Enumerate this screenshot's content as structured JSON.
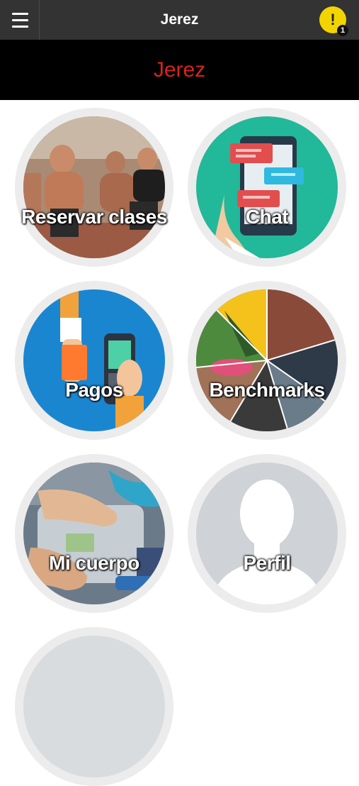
{
  "header": {
    "title": "Jerez",
    "notification_count": "1",
    "alert_symbol": "!"
  },
  "banner": {
    "title": "Jerez"
  },
  "tiles": [
    {
      "label": "Reservar clases",
      "icon": "athletes-photo"
    },
    {
      "label": "Chat",
      "icon": "chat-phone-icon"
    },
    {
      "label": "Pagos",
      "icon": "payment-terminal-icon"
    },
    {
      "label": "Benchmarks",
      "icon": "collage-photo"
    },
    {
      "label": "Mi cuerpo",
      "icon": "scale-photo"
    },
    {
      "label": "Perfil",
      "icon": "profile-silhouette-icon"
    }
  ],
  "colors": {
    "topbar": "#333333",
    "banner": "#000000",
    "banner_text": "#d8231e",
    "alert": "#f2d500",
    "tile_ring": "#ececec"
  }
}
